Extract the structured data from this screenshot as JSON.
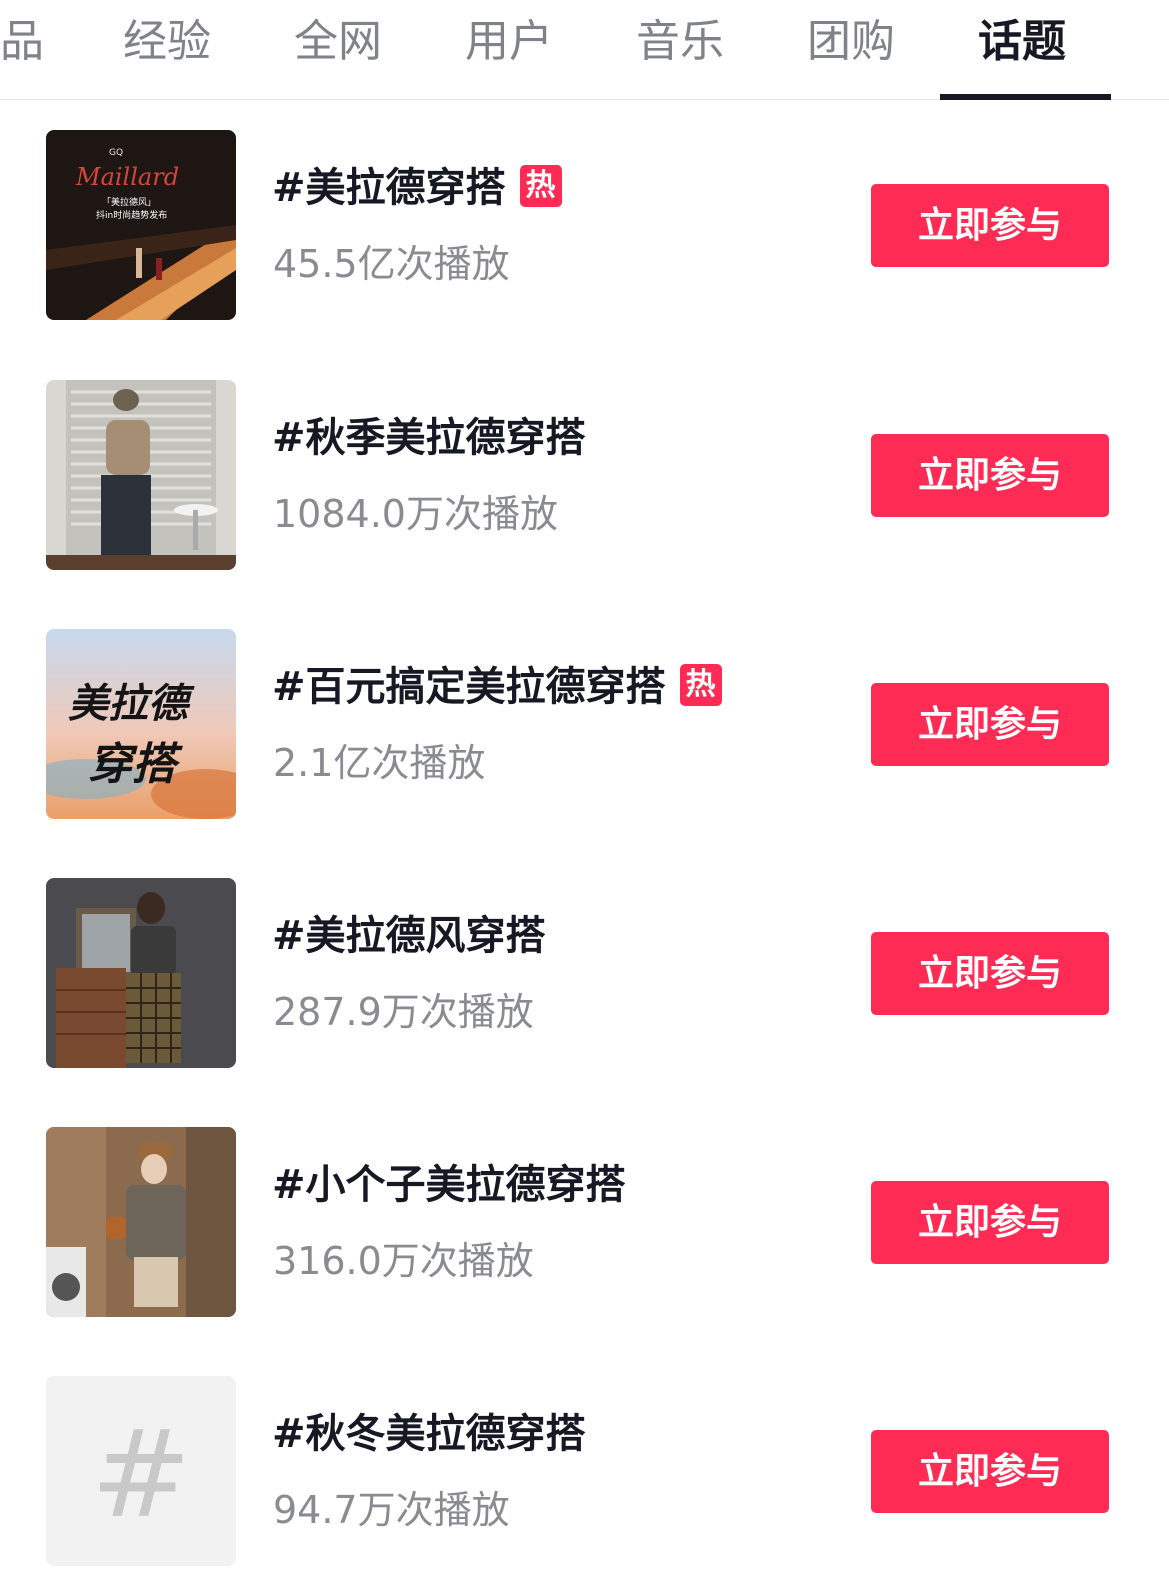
{
  "tabs": [
    {
      "label": "品",
      "active": false
    },
    {
      "label": "经验",
      "active": false
    },
    {
      "label": "全网",
      "active": false
    },
    {
      "label": "用户",
      "active": false
    },
    {
      "label": "音乐",
      "active": false
    },
    {
      "label": "团购",
      "active": false
    },
    {
      "label": "话题",
      "active": true
    }
  ],
  "topics": [
    {
      "title": "#美拉德穿搭",
      "hot": true,
      "hot_label": "热",
      "plays": "45.5亿次播放",
      "button": "立即参与"
    },
    {
      "title": "#秋季美拉德穿搭",
      "hot": false,
      "plays": "1084.0万次播放",
      "button": "立即参与"
    },
    {
      "title": "#百元搞定美拉德穿搭",
      "hot": true,
      "hot_label": "热",
      "plays": "2.1亿次播放",
      "button": "立即参与"
    },
    {
      "title": "#美拉德风穿搭",
      "hot": false,
      "plays": "287.9万次播放",
      "button": "立即参与"
    },
    {
      "title": "#小个子美拉德穿搭",
      "hot": false,
      "plays": "316.0万次播放",
      "button": "立即参与"
    },
    {
      "title": "#秋冬美拉德穿搭",
      "hot": false,
      "plays": "94.7万次播放",
      "button": "立即参与"
    }
  ],
  "thumbnails": {
    "t1_brand": "GQ",
    "t1_script": "Maillard",
    "t1_caption1": "「美拉德风」",
    "t1_caption2": "抖in时尚趋势发布",
    "t3_line1": "美拉德",
    "t3_line2": "穿搭",
    "t6_symbol": "#"
  },
  "colors": {
    "accent": "#fe2c55",
    "text_primary": "#161823",
    "text_secondary": "#8a8b91",
    "tab_inactive": "#80828a"
  }
}
